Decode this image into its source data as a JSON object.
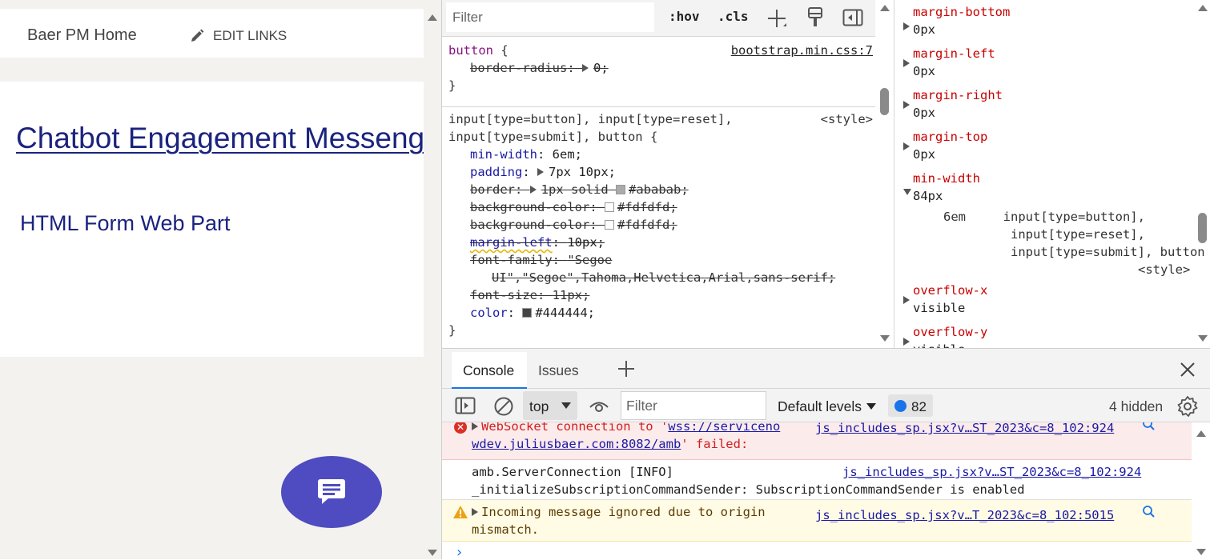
{
  "page": {
    "nav_home": "Baer PM Home",
    "nav_edit_links": "EDIT LINKS",
    "title": "Chatbot Engagement Messeng",
    "webpart_title": "HTML Form Web Part"
  },
  "styles": {
    "filter_placeholder": "Filter",
    "hov": ":hov",
    "cls": ".cls",
    "rule1": {
      "selector": "button",
      "source": "bootstrap.min.css:7",
      "decl_prop": "border-radius",
      "decl_val": "0;"
    },
    "rule2": {
      "selector_line1": "input[type=button], input[type=reset],",
      "selector_line2": "input[type=submit], button",
      "source": "<style>",
      "min_width_prop": "min-width",
      "min_width_val": "6em;",
      "padding_prop": "padding",
      "padding_val": "7px 10px;",
      "border_prop": "border",
      "border_val_a": "1px solid",
      "border_val_b": "#ababab;",
      "bg1_prop": "background-color",
      "bg1_val": "#fdfdfd;",
      "bg2_prop": "background-color",
      "bg2_val": "#fdfdfd;",
      "margin_prop": "margin-left",
      "margin_val": "10px;",
      "font_prop": "font-family",
      "font_val_line1": "\"Segoe",
      "font_val_line2": "UI\",\"Segoe\",Tahoma,Helvetica,Arial,sans-serif;",
      "size_prop": "font-size",
      "size_val": "11px;",
      "color_prop": "color",
      "color_val": "#444444;"
    },
    "swatch_colors": {
      "border": "#ababab",
      "bg": "#fdfdfd",
      "color": "#444444"
    }
  },
  "computed": {
    "props": [
      {
        "name": "margin-bottom",
        "value": "0px"
      },
      {
        "name": "margin-left",
        "value": "0px"
      },
      {
        "name": "margin-right",
        "value": "0px"
      },
      {
        "name": "margin-top",
        "value": "0px"
      },
      {
        "name": "min-width",
        "value": "84px"
      },
      {
        "name": "overflow-x",
        "value": "visible"
      },
      {
        "name": "overflow-y",
        "value": "visible"
      }
    ],
    "trace_value": "6em",
    "trace_selector_1": "input[type=button],",
    "trace_selector_2": "input[type=reset],",
    "trace_selector_3": "input[type=submit], button",
    "trace_source": "<style>"
  },
  "drawer": {
    "tab_console": "Console",
    "tab_issues": "Issues",
    "context": "top",
    "filter_placeholder": "Filter",
    "default_levels": "Default levels",
    "issues_count": "82",
    "hidden": "4 hidden",
    "messages": {
      "error_line1_a": "WebSocket connection to '",
      "error_link_a": "wss://serviceno",
      "error_link_b": "wdev.juliusbaer.com:8082/amb",
      "error_line2_b": "' failed:",
      "error_source": "js_includes_sp.jsx?v…ST_2023&c=8_102:924",
      "info_line1": "amb.ServerConnection [INFO]",
      "info_line2": "_initializeSubscriptionCommandSender: SubscriptionCommandSender is enabled",
      "info_source": "js_includes_sp.jsx?v…ST_2023&c=8_102:924",
      "warn_line1": "Incoming message ignored due to origin",
      "warn_line2": "mismatch.",
      "warn_source": "js_includes_sp.jsx?v…T_2023&c=8_102:5015"
    }
  },
  "colors": {
    "page_title": "#1a237e",
    "chat_fab": "#4e4cc0",
    "error_text": "#d31e1e",
    "link": "#1a1aa6",
    "css_prop": "#c80000",
    "selector_keyword": "#881280",
    "accent": "#1a73e8"
  },
  "icons": [
    "pencil-icon",
    "chat-icon",
    "plus-icon",
    "paint-brush-icon",
    "sidebar-icon",
    "close-icon",
    "clear-console-icon",
    "eye-icon",
    "settings-gear-icon",
    "magnifier-icon",
    "error-icon",
    "warning-icon"
  ]
}
